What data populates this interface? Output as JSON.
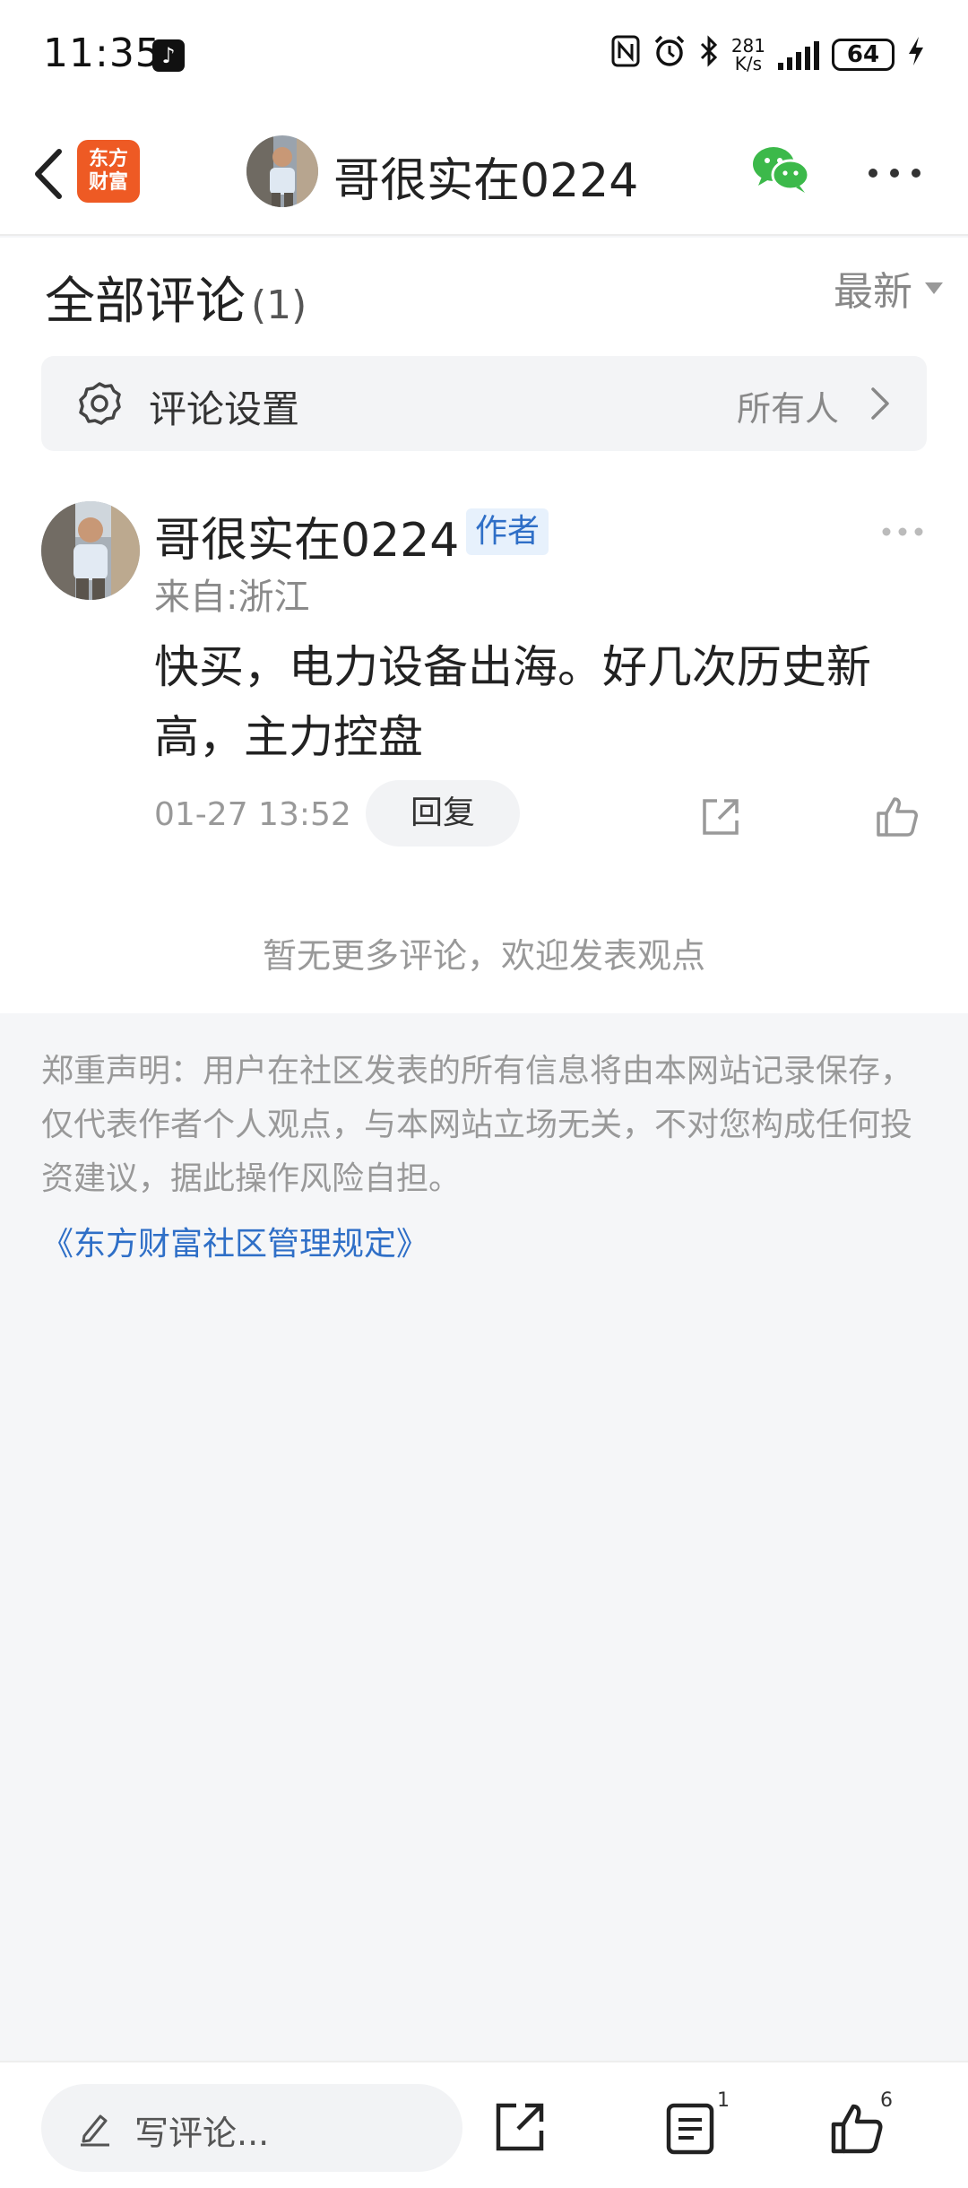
{
  "status_bar": {
    "time": "11:35",
    "app_icon": "tiktok-icon",
    "icons": [
      "nfc-icon",
      "alarm-icon",
      "bluetooth-icon"
    ],
    "network_speed_value": "281",
    "network_speed_unit": "K/s",
    "battery": "64"
  },
  "header": {
    "back_icon": "back-chevron-icon",
    "logo_line1": "东方",
    "logo_line2": "财富",
    "title": "哥很实在0224",
    "share_icon": "wechat-icon",
    "more_icon": "more-dots-icon"
  },
  "comments": {
    "title": "全部评论",
    "count": "(1)",
    "sort_label": "最新",
    "settings": {
      "label": "评论设置",
      "value": "所有人"
    },
    "items": [
      {
        "user": "哥很实在0224",
        "badge": "作者",
        "location": "来自:浙江",
        "text": "快买，电力设备出海。好几次历史新高，主力控盘",
        "time": "01-27 13:52",
        "reply_label": "回复"
      }
    ],
    "no_more": "暂无更多评论，欢迎发表观点"
  },
  "disclaimer": {
    "text": "郑重声明：用户在社区发表的所有信息将由本网站记录保存，仅代表作者个人观点，与本网站立场无关，不对您构成任何投资建议，据此操作风险自担。",
    "link": "《东方财富社区管理规定》"
  },
  "bottom_bar": {
    "write_placeholder": "写评论...",
    "comment_count": "1",
    "like_count": "6"
  },
  "colors": {
    "brand": "#ee5a24",
    "link": "#2f6fc7",
    "wechat": "#3cb94a"
  }
}
